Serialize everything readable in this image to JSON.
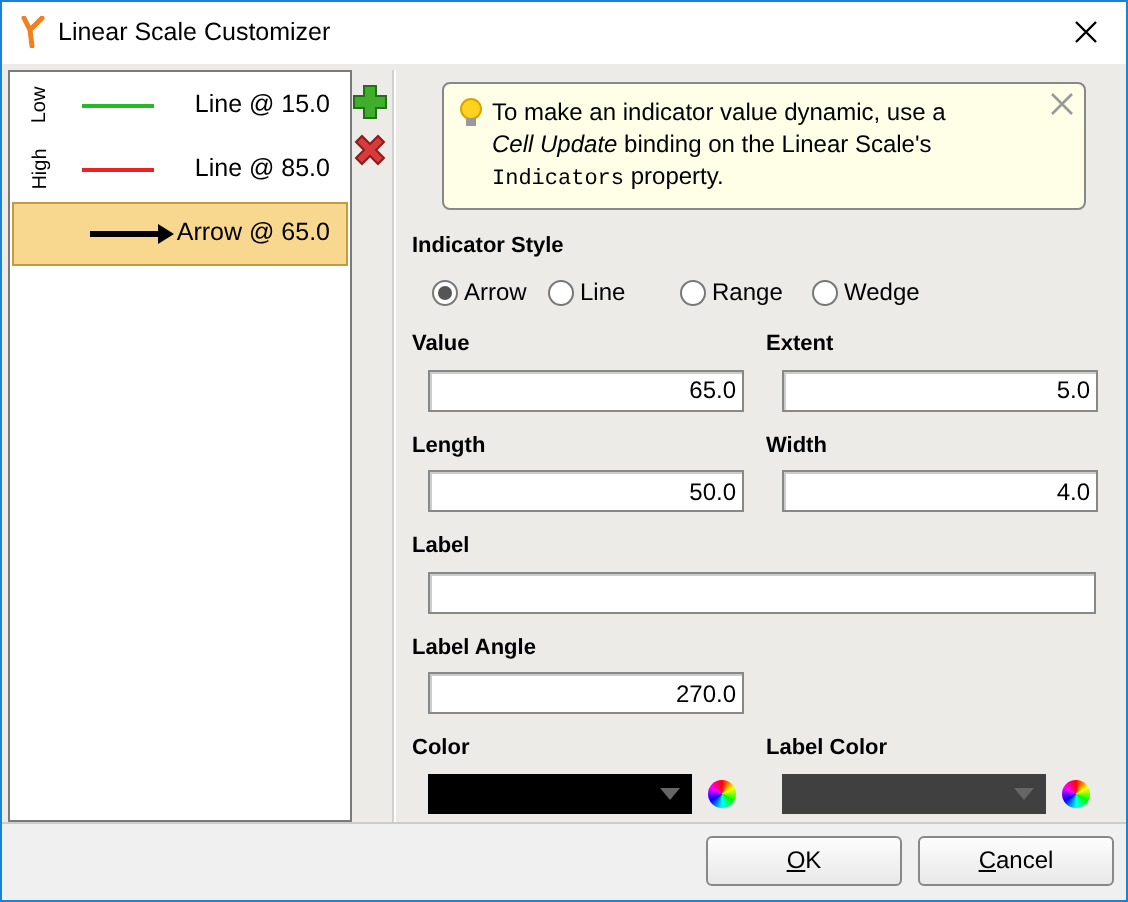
{
  "window": {
    "title": "Linear Scale Customizer"
  },
  "indicators": [
    {
      "kind": "line",
      "marker": "Low",
      "color": "#22bb22",
      "label": "Line @ 15.0",
      "selected": false
    },
    {
      "kind": "line",
      "marker": "High",
      "color": "#ee2222",
      "label": "Line @ 85.0",
      "selected": false
    },
    {
      "kind": "arrow",
      "color": "#000000",
      "label": "Arrow @ 65.0",
      "selected": true
    }
  ],
  "hint": [
    {
      "kind": "plain",
      "text": "To make an indicator value dynamic, use a "
    },
    {
      "kind": "italic",
      "text": "Cell Update"
    },
    {
      "kind": "plain",
      "text": " binding on the Linear Scale's "
    },
    {
      "kind": "code",
      "text": "Indicators"
    },
    {
      "kind": "plain",
      "text": " property."
    }
  ],
  "indicator_style": {
    "label": "Indicator Style",
    "options": [
      {
        "label": "Arrow",
        "selected": true
      },
      {
        "label": "Line",
        "selected": false
      },
      {
        "label": "Range",
        "selected": false
      },
      {
        "label": "Wedge",
        "selected": false
      }
    ]
  },
  "fields": [
    [
      {
        "label": "Value",
        "value": "65.0"
      },
      {
        "label": "Extent",
        "value": "5.0"
      }
    ],
    [
      {
        "label": "Length",
        "value": "50.0"
      },
      {
        "label": "Width",
        "value": "4.0"
      }
    ]
  ],
  "label_field": {
    "label": "Label"
  },
  "label_angle": {
    "label": "Label Angle",
    "value": "270.0"
  },
  "colors": [
    {
      "label": "Color",
      "color": "#000000"
    },
    {
      "label": "Label Color",
      "color": "#404040"
    }
  ],
  "buttons": [
    "OK",
    "Cancel"
  ]
}
